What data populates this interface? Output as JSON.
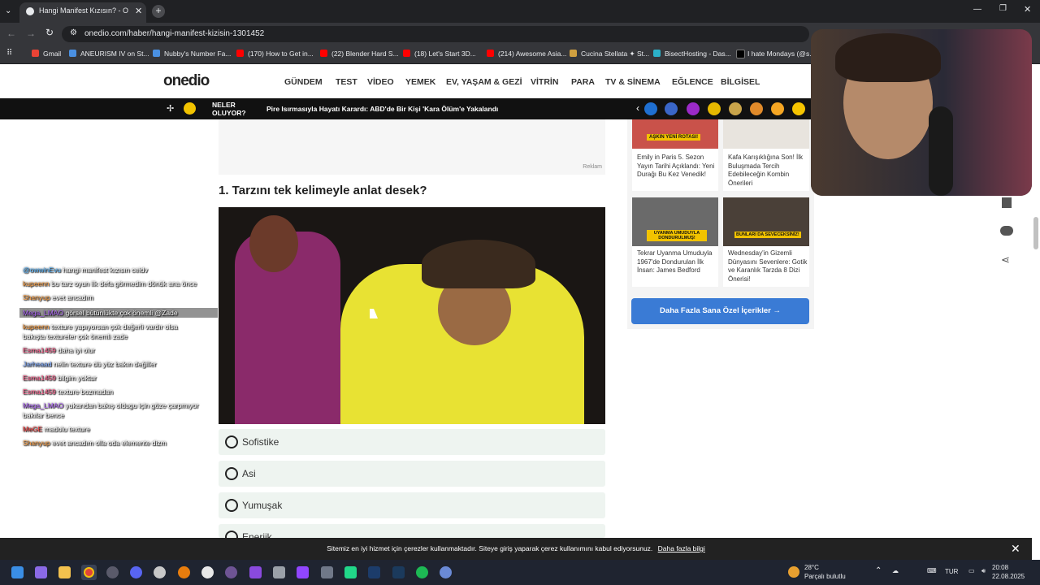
{
  "browser": {
    "tab_title": "Hangi Manifest Kızısın? - Onedio",
    "url": "onedio.com/haber/hangi-manifest-kizisin-1301452",
    "bookmarks": [
      "Gmail",
      "ANEURISM IV on St...",
      "Nubby's Number Fa...",
      "(170) How to Get in...",
      "(22) Blender Hard S...",
      "(18) Let's Start 3D...",
      "(214) Awesome Asia...",
      "Cucina Stellata ✦ St...",
      "BisectHosting - Das...",
      "I hate Mondays (@s..."
    ]
  },
  "site": {
    "logo": "onedio",
    "nav": [
      "GÜNDEM",
      "TEST",
      "VİDEO",
      "YEMEK",
      "EV, YAŞAM & GEZİ",
      "VİTRİN",
      "PARA",
      "TV & SİNEMA",
      "EĞLENCE",
      "BİLGİSEL"
    ],
    "newsbar": {
      "label_line1": "NELER",
      "label_line2": "OLUYOR?",
      "headline": "Pire Isırmasıyla Hayatı Karardı: ABD'de Bir Kişi 'Kara Ölüm'e Yakalandı"
    },
    "ad_label": "Reklam",
    "question_title": "1. Tarzını tek kelimeyle anlat desek?",
    "options": [
      "Sofistike",
      "Asi",
      "Yumuşak",
      "Enerjik"
    ],
    "sidebar_cards": [
      {
        "badge": "AŞKIN YENİ ROTASI!",
        "text": "Emily in Paris 5. Sezon Yayın Tarihi Açıklandı: Yeni Durağı Bu Kez Venedik!"
      },
      {
        "badge": "",
        "text": "Kafa Karışıklığına Son! İlk Buluşmada Tercih Edebileceğin Kombin Önerileri"
      },
      {
        "badge": "UYANMA UMUDUYLA DONDURULMUŞ!",
        "text": "Tekrar Uyanma Umuduyla 1967'de Dondurulan İlk İnsan: James Bedford"
      },
      {
        "badge": "BUNLARI DA SEVECEKSİNİZ!",
        "text": "Wednesday'in Gizemli Dünyasını Sevenlere: Gotik ve Karanlık Tarzda 8 Dizi Önerisi!"
      }
    ],
    "more_button": "Daha Fazla Sana Özel İçerikler →",
    "cookie": {
      "text": "Sitemiz en iyi hizmet için çerezler kullanmaktadır. Siteye giriş yaparak çerez kullanımını kabul ediyorsunuz.",
      "link": "Daha fazla bilgi"
    }
  },
  "chat": [
    {
      "user": "@owwinEvu",
      "msg": "hangi manifest kızısın ceidv"
    },
    {
      "user": "kupeenn",
      "msg": "bu tarz oyun ilk defa görmedim dönük ana önce"
    },
    {
      "user": "Shanyup",
      "msg": "evet ancadım"
    },
    {
      "user": "Mega_LMAO",
      "msg": "görsel bütünlükte çok önemli @Zade"
    },
    {
      "user": "kupeenn",
      "msg": "texture yapıyorsan çok değerli vardır olsa"
    },
    {
      "user": "",
      "msg": "bakışta textureler çok önemli zade"
    },
    {
      "user": "Esma1459",
      "msg": "daha iyi olur"
    },
    {
      "user": "Jarheaad",
      "msg": "nelin texture dü yüz bakın değiller"
    },
    {
      "user": "Esma1459",
      "msg": "bilgim yoktur"
    },
    {
      "user": "Esma1459",
      "msg": "texture bozmadan"
    },
    {
      "user": "Mega_LMAO",
      "msg": "yukarıdan bakış oldugu için göze çarpmıyor"
    },
    {
      "user": "",
      "msg": "bakılar bence"
    },
    {
      "user": "MeGE",
      "msg": "madolu texture"
    },
    {
      "user": "Shanyup",
      "msg": "evet ancadım olla oda elemente dizm"
    }
  ],
  "taskbar": {
    "weather_temp": "28°C",
    "weather_desc": "Parçalı bulutlu",
    "lang": "TUR",
    "time": "20:08",
    "date": "22.08.2025"
  },
  "colors": {
    "accent_blue": "#3a7bd5",
    "option_bg": "#eef4f0",
    "newsbar_bg": "#111111"
  }
}
